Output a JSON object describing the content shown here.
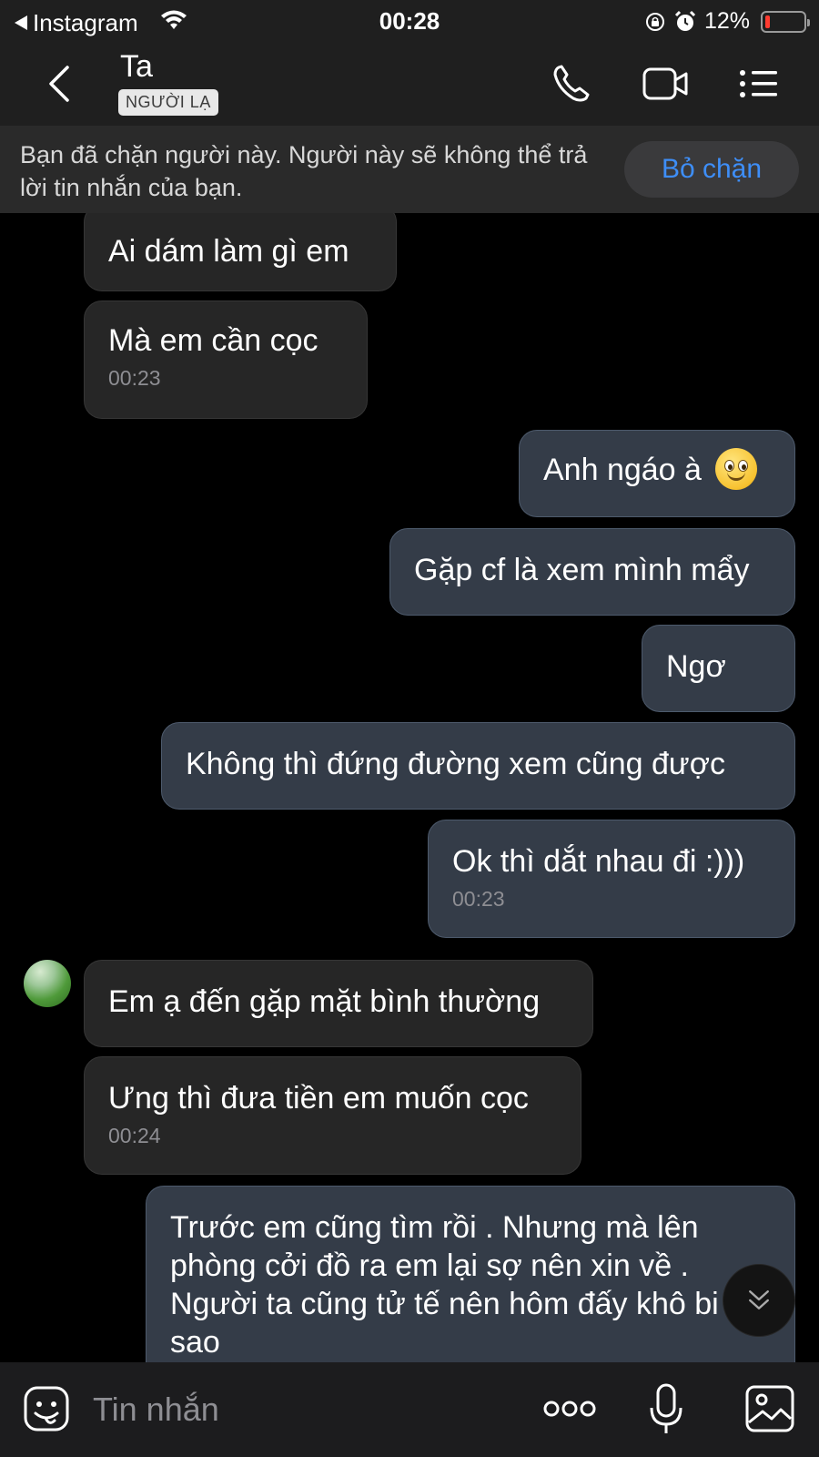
{
  "status_bar": {
    "back_app": "Instagram",
    "time": "00:28",
    "battery_text": "12%",
    "battery_level": 0.12
  },
  "header": {
    "name": "Ta",
    "badge": "NGƯỜI LẠ",
    "icons": [
      "back-chevron-icon",
      "phone-icon",
      "video-camera-icon",
      "menu-list-icon"
    ]
  },
  "banner": {
    "text": "Bạn đã chặn người này. Người này sẽ không thể trả lời tin nhắn của bạn.",
    "button": "Bỏ chặn"
  },
  "messages": [
    {
      "side": "received",
      "text": "Ai dám làm gì em",
      "time": ""
    },
    {
      "side": "received",
      "text": "Mà em cần cọc",
      "time": "00:23"
    },
    {
      "side": "sent",
      "text": "Anh ngáo à",
      "time": "",
      "emoji": "smiling-face-emoji"
    },
    {
      "side": "sent",
      "text": "Gặp cf là xem mình mẩy",
      "time": ""
    },
    {
      "side": "sent",
      "text": "Ngơ",
      "time": ""
    },
    {
      "side": "sent",
      "text": "Không thì đứng đường xem cũng được",
      "time": ""
    },
    {
      "side": "sent",
      "text": "Ok thì dắt nhau đi :)))",
      "time": "00:23"
    },
    {
      "side": "received",
      "text": "Em ạ đến gặp mặt bình thường",
      "time": ""
    },
    {
      "side": "received",
      "text": "Ưng thì đưa tiền em muốn cọc",
      "time": "00:24"
    },
    {
      "side": "sent",
      "text": "Trước em cũng tìm rồi . Nhưng mà lên phòng cởi đồ ra em lại sợ nên xin về . Người ta cũng tử tế nên hôm đấy khô bi sao",
      "time": ""
    }
  ],
  "composer": {
    "placeholder": "Tin nhắn",
    "icons": [
      "sticker-icon",
      "more-icon",
      "microphone-icon",
      "image-icon"
    ]
  },
  "colors": {
    "background": "#000000",
    "header": "#1f1f1f",
    "received_bubble": "#262626",
    "sent_bubble": "#343c48",
    "accent_blue": "#3e8ef7",
    "battery_low": "#ff3b30"
  }
}
